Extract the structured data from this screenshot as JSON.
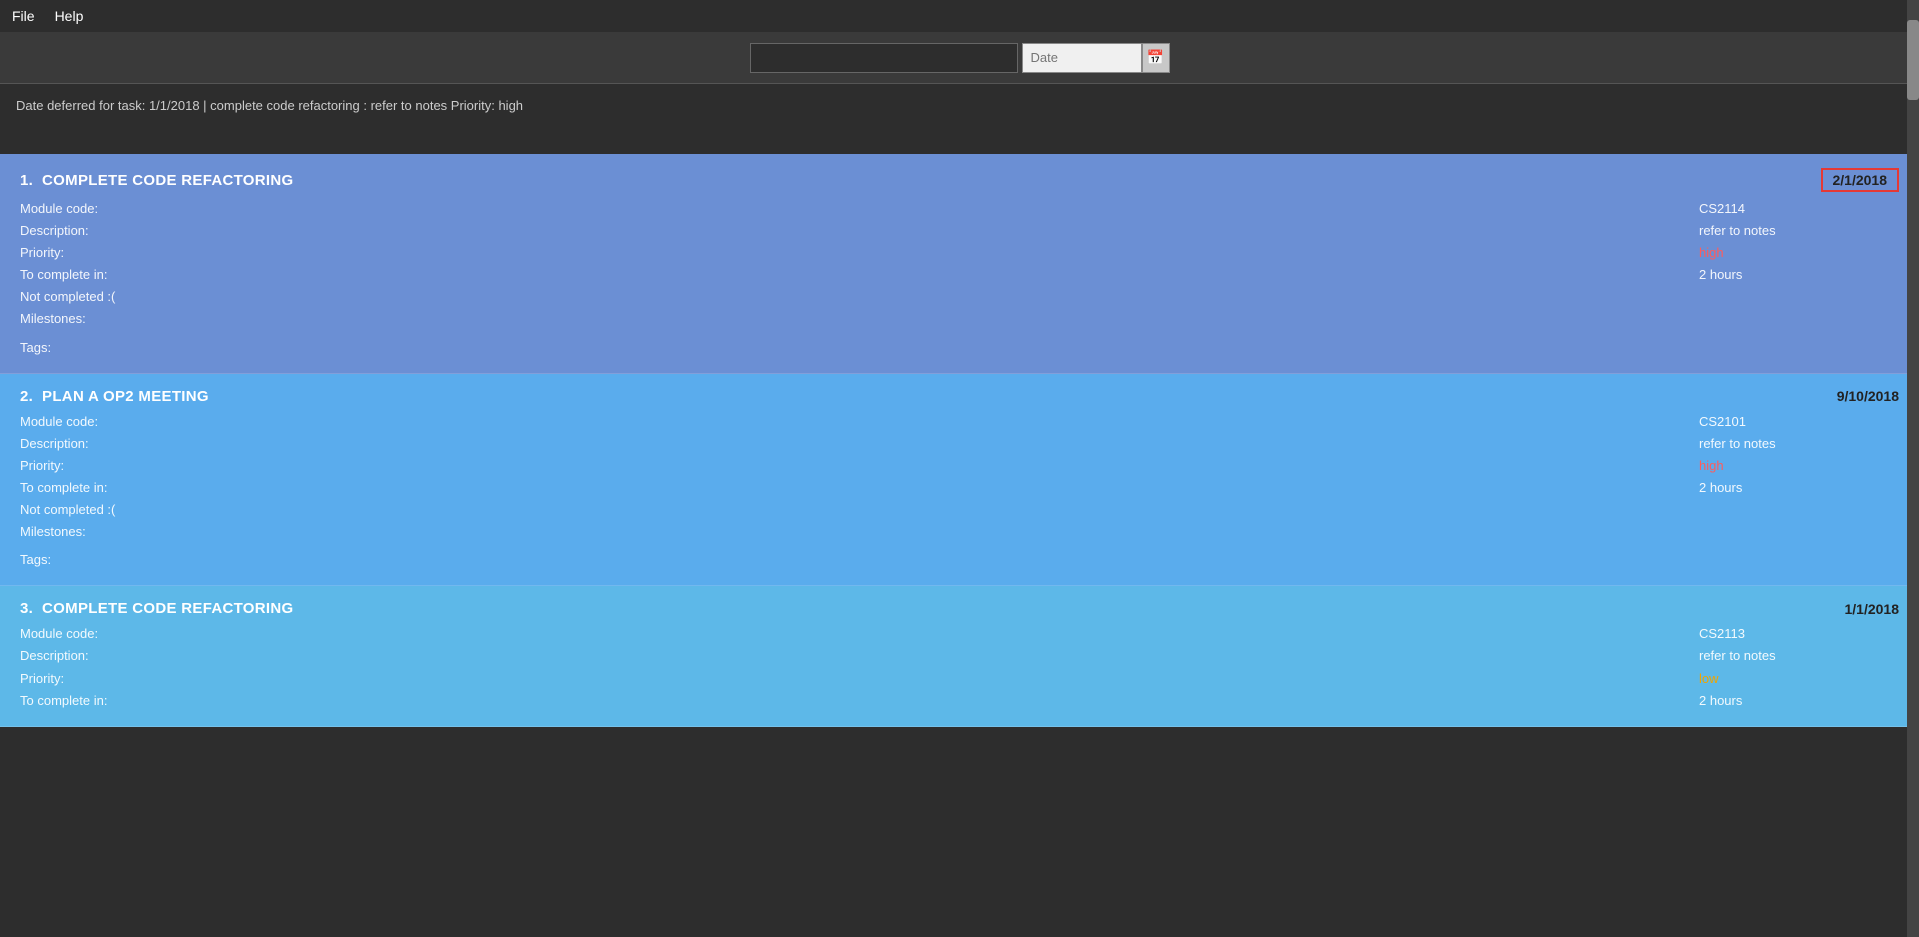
{
  "menu": {
    "file_label": "File",
    "help_label": "Help"
  },
  "search": {
    "text_placeholder": "",
    "date_placeholder": "Date",
    "date_icon": "📅"
  },
  "info_bar": {
    "text": "Date deferred for task: 1/1/2018 | complete code refactoring : refer to notes Priority: high"
  },
  "tasks": [
    {
      "number": "1.",
      "title": "COMPLETE CODE REFACTORING",
      "date": "2/1/2018",
      "date_highlighted": true,
      "module_code_label": "Module code:",
      "module_code": "CS2114",
      "description_label": "Description:",
      "description": "refer to notes",
      "priority_label": "Priority:",
      "priority": "high",
      "priority_class": "priority-high",
      "to_complete_label": "To complete in:",
      "to_complete": "2 hours",
      "not_completed_label": "Not completed :(",
      "milestones_label": "Milestones:",
      "milestones": "",
      "tags_label": "Tags:",
      "tags": ""
    },
    {
      "number": "2.",
      "title": "PLAN A OP2 MEETING",
      "date": "9/10/2018",
      "date_highlighted": false,
      "module_code_label": "Module code:",
      "module_code": "CS2101",
      "description_label": "Description:",
      "description": "refer to notes",
      "priority_label": "Priority:",
      "priority": "high",
      "priority_class": "priority-high",
      "to_complete_label": "To complete in:",
      "to_complete": "2 hours",
      "not_completed_label": "Not completed :(",
      "milestones_label": "Milestones:",
      "milestones": "",
      "tags_label": "Tags:",
      "tags": ""
    },
    {
      "number": "3.",
      "title": "COMPLETE CODE REFACTORING",
      "date": "1/1/2018",
      "date_highlighted": false,
      "module_code_label": "Module code:",
      "module_code": "CS2113",
      "description_label": "Description:",
      "description": "refer to notes",
      "priority_label": "Priority:",
      "priority": "low",
      "priority_class": "priority-low",
      "to_complete_label": "To complete in:",
      "to_complete": "2 hours",
      "not_completed_label": "",
      "milestones_label": "",
      "milestones": "",
      "tags_label": "",
      "tags": ""
    }
  ],
  "labels": {
    "module_code": "Module code:",
    "description": "Description:",
    "priority": "Priority:",
    "to_complete": "To complete in:",
    "not_completed": "Not completed :(",
    "milestones": "Milestones:",
    "tags": "Tags:"
  }
}
